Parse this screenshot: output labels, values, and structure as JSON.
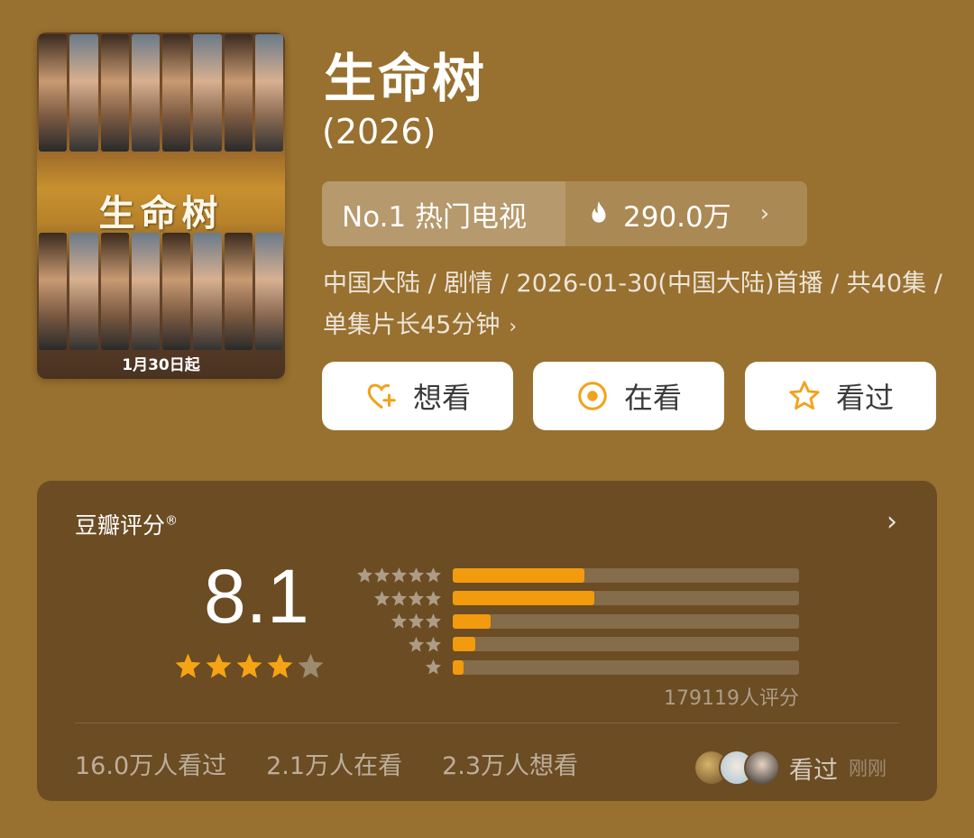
{
  "poster": {
    "title_art": "生命树",
    "date_text": "1月30日起"
  },
  "title": "生命树",
  "year": "(2026)",
  "rank": {
    "label": "No.1 热门电视",
    "heat": "290.0万",
    "fire_icon": "fire-icon",
    "chevron": "›"
  },
  "meta": {
    "text": "中国大陆 / 剧情 / 2026-01-30(中国大陆)首播 / 共40集 / 单集片长45分钟",
    "chevron": "›"
  },
  "actions": [
    {
      "label": "想看",
      "icon": "heart-plus-icon"
    },
    {
      "label": "在看",
      "icon": "target-icon"
    },
    {
      "label": "看过",
      "icon": "star-outline-icon"
    }
  ],
  "rating": {
    "title": "豆瓣评分",
    "reg": "®",
    "score": "8.1",
    "stars_filled": 4,
    "stars_total": 5,
    "distribution": [
      {
        "stars": 5,
        "fraction": 0.38
      },
      {
        "stars": 4,
        "fraction": 0.41
      },
      {
        "stars": 3,
        "fraction": 0.11
      },
      {
        "stars": 2,
        "fraction": 0.065
      },
      {
        "stars": 1,
        "fraction": 0.03
      }
    ],
    "count": "179119人评分",
    "chevron": "›"
  },
  "stats": {
    "watched": "16.0万人看过",
    "watching": "2.1万人在看",
    "want": "2.3万人想看"
  },
  "friends": {
    "action": "看过",
    "time": "刚刚"
  },
  "colors": {
    "background": "#98702f",
    "card": "#6b4c23",
    "accent": "#f39b0e",
    "star_on": "#f6a315"
  }
}
